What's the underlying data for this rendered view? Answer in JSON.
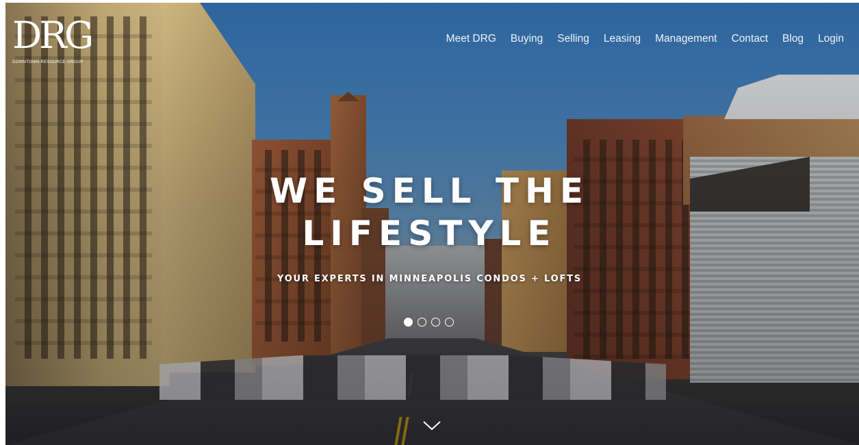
{
  "logo": {
    "mark": "DRG",
    "tagline": "DOWNTOWN RESOURCE GROUP"
  },
  "nav": {
    "items": [
      "Meet DRG",
      "Buying",
      "Selling",
      "Leasing",
      "Management",
      "Contact",
      "Blog",
      "Login"
    ]
  },
  "hero": {
    "headline_line1": "WE SELL THE",
    "headline_line2": "LIFESTYLE",
    "subheadline": "YOUR EXPERTS IN MINNEAPOLIS CONDOS + LOFTS",
    "slides_total": 4,
    "active_slide": 1
  },
  "icons": {
    "scroll": "chevron-down-icon"
  },
  "colors": {
    "text": "#ffffff",
    "lane_line": "#c9a11a",
    "sky": "#4b86bf"
  }
}
